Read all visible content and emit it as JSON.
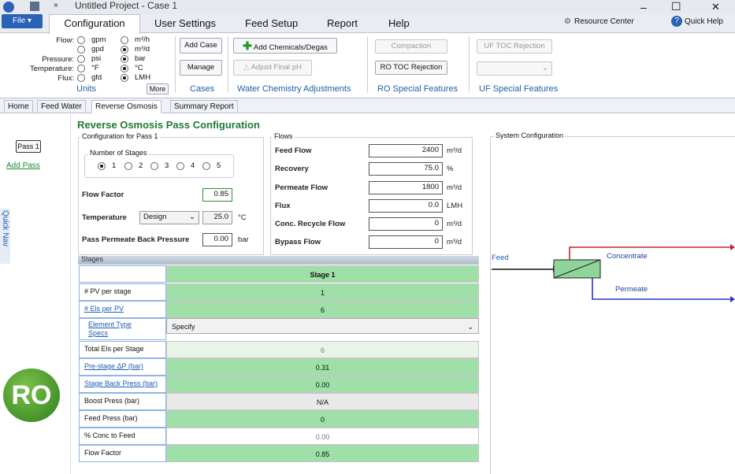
{
  "window": {
    "title": "Untitled Project - Case 1",
    "controls": [
      "–",
      "☐",
      "✕"
    ]
  },
  "ribbon": {
    "file_label": "File ▾",
    "tabs": [
      "Configuration",
      "User Settings",
      "Feed Setup",
      "Report",
      "Help"
    ],
    "resource_center": "Resource Center",
    "quick_help": "Quick Help",
    "units": {
      "labels": [
        "Flow:",
        "Pressure:",
        "Temperature:",
        "Flux:"
      ],
      "options_left": [
        "gpm",
        "gpd",
        "psi",
        "°F",
        "gfd"
      ],
      "options_right": [
        "m³/h",
        "m³/d",
        "bar",
        "°C",
        "LMH"
      ],
      "more": "More",
      "group": "Units"
    },
    "cases": {
      "add": "Add Case",
      "manage": "Manage",
      "group": "Cases"
    },
    "chem": {
      "add": "Add Chemicals/Degas",
      "adjust": "Adjust Final pH",
      "group": "Water Chemistry Adjustments"
    },
    "ro": {
      "compaction": "Compaction",
      "toc": "RO TOC Rejection",
      "group": "RO Special Features"
    },
    "uf": {
      "toc": "UF TOC Rejection",
      "group": "UF Special Features"
    }
  },
  "page_tabs": [
    "Home",
    "Feed Water",
    "Reverse Osmosis",
    "Summary Report"
  ],
  "left": {
    "pass_button": "Pass 1",
    "add_pass": "Add Pass",
    "quick_nav": "Quick Nav",
    "logo": "RO"
  },
  "config": {
    "title": "Reverse Osmosis Pass Configuration",
    "subtitle": "Configuration for Pass 1",
    "stages_legend": "Number of Stages",
    "stage_options": [
      "1",
      "2",
      "3",
      "4",
      "5"
    ],
    "flow_factor_label": "Flow Factor",
    "flow_factor": "0.85",
    "temperature_label": "Temperature",
    "temperature_mode": "Design",
    "temperature": "25.0",
    "temperature_unit": "°C",
    "back_pressure_label": "Pass Permeate Back Pressure",
    "back_pressure": "0.00",
    "back_pressure_unit": "bar"
  },
  "flows": {
    "legend": "Flows",
    "items": [
      {
        "label": "Feed Flow",
        "value": "2400",
        "unit": "m³/d"
      },
      {
        "label": "Recovery",
        "value": "75.0",
        "unit": "%"
      },
      {
        "label": "Permeate Flow",
        "value": "1800",
        "unit": "m³/d"
      },
      {
        "label": "Flux",
        "value": "0.0",
        "unit": "LMH"
      },
      {
        "label": "Conc. Recycle Flow",
        "value": "0",
        "unit": "m³/d"
      },
      {
        "label": "Bypass Flow",
        "value": "0",
        "unit": "m³/d"
      }
    ]
  },
  "stages": {
    "header": "Stages",
    "col_header": "Stage 1",
    "rows": [
      {
        "label": "# PV per stage",
        "value": "1"
      },
      {
        "label": "# Els per PV",
        "value": "6"
      },
      {
        "label": "Element Type Specs",
        "value": "Specify"
      },
      {
        "label": "Total Els per Stage",
        "value": "6"
      },
      {
        "label": "Pre-stage ΔP (bar)",
        "value": "0.31"
      },
      {
        "label": "Stage Back Press (bar)",
        "value": "0.00"
      },
      {
        "label": "Boost Press (bar)",
        "value": "N/A"
      },
      {
        "label": "Feed Press (bar)",
        "value": "0"
      },
      {
        "label": "% Conc to Feed",
        "value": "0.00"
      },
      {
        "label": "Flow Factor",
        "value": "0.85"
      }
    ]
  },
  "system": {
    "legend": "System Configuration",
    "feed": "Feed",
    "concentrate": "Concentrate",
    "permeate": "Permeate"
  }
}
